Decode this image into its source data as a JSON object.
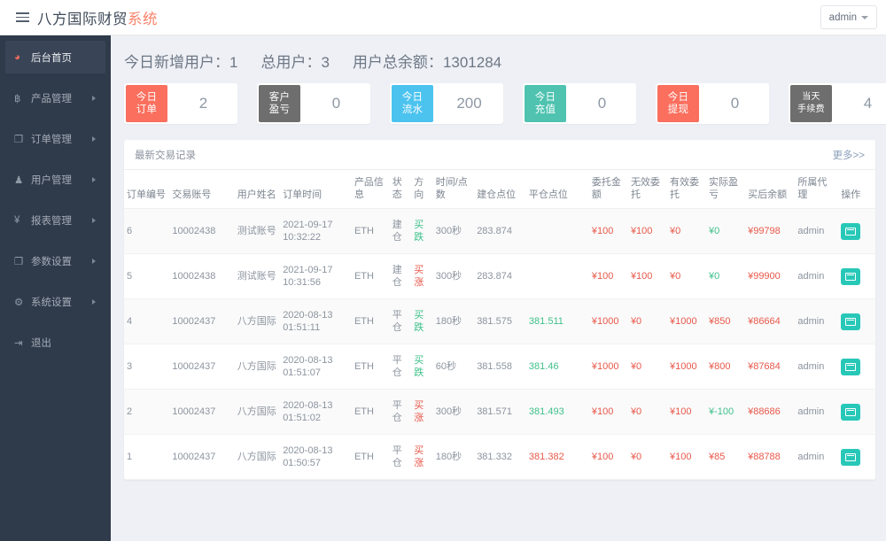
{
  "topbar": {
    "menu_icon": "hamburger-icon",
    "brand_main": "八方国际财贸",
    "brand_accent": "系统",
    "user_label": "admin"
  },
  "sidebar": {
    "items": [
      {
        "label": "后台首页",
        "icon": "dashboard-icon",
        "icon_glyph": "◕",
        "active": true,
        "arrow": false
      },
      {
        "label": "产品管理",
        "icon": "bitcoin-icon",
        "icon_glyph": "฿",
        "active": false,
        "arrow": true
      },
      {
        "label": "订单管理",
        "icon": "copy-icon",
        "icon_glyph": "❐",
        "active": false,
        "arrow": true
      },
      {
        "label": "用户管理",
        "icon": "user-icon",
        "icon_glyph": "♟",
        "active": false,
        "arrow": true
      },
      {
        "label": "报表管理",
        "icon": "yen-icon",
        "icon_glyph": "¥",
        "active": false,
        "arrow": true
      },
      {
        "label": "参数设置",
        "icon": "copy-icon",
        "icon_glyph": "❐",
        "active": false,
        "arrow": true
      },
      {
        "label": "系统设置",
        "icon": "gears-icon",
        "icon_glyph": "⚙",
        "active": false,
        "arrow": true
      },
      {
        "label": "退出",
        "icon": "logout-icon",
        "icon_glyph": "⇥",
        "active": false,
        "arrow": false
      }
    ]
  },
  "stats": [
    {
      "label": "今日新增用户：",
      "value": "1"
    },
    {
      "label": "总用户：",
      "value": "3"
    },
    {
      "label": "用户总余额：",
      "value": "1301284"
    }
  ],
  "cards": [
    {
      "tag": "今日订单",
      "tag_line1": "今日",
      "tag_line2": "订单",
      "value": "2",
      "color": "#fa6f5e"
    },
    {
      "tag": "客户盈亏",
      "tag_line1": "客户",
      "tag_line2": "盈亏",
      "value": "0",
      "color": "#6e6e6e"
    },
    {
      "tag": "今日流水",
      "tag_line1": "今日",
      "tag_line2": "流水",
      "value": "200",
      "color": "#4cc3ef"
    },
    {
      "tag": "今日充值",
      "tag_line1": "今日",
      "tag_line2": "充值",
      "value": "0",
      "color": "#4fc3b0"
    },
    {
      "tag": "今日提现",
      "tag_line1": "今日",
      "tag_line2": "提现",
      "value": "0",
      "color": "#fa6f5e"
    },
    {
      "tag": "当天手续费",
      "tag_line1": "当天",
      "tag_line2": "手续费",
      "value": "4",
      "color": "#6e6e6e"
    }
  ],
  "panel": {
    "title": "最新交易记录",
    "more_label": "更多>>",
    "columns": [
      "订单编号",
      "交易账号",
      "用户姓名",
      "订单时间",
      "产品信息",
      "状态",
      "方向",
      "时间/点数",
      "建仓点位",
      "平仓点位",
      "委托金额",
      "无效委托",
      "有效委托",
      "实际盈亏",
      "买后余额",
      "所属代理",
      "操作"
    ],
    "rows": [
      {
        "id": "6",
        "account": "10002438",
        "name": "测试账号",
        "order_time": "2021-09-17 10:32:22",
        "product": "ETH",
        "status": "建仓",
        "direction": "买跌",
        "direction_color": "green",
        "duration": "300秒",
        "open_price": "283.874",
        "close_price": "",
        "close_color": "gray",
        "entrust_amount": "¥100",
        "invalid_entrust": "¥100",
        "valid_entrust": "¥0",
        "profit": "¥0",
        "profit_color": "green",
        "balance": "¥99798",
        "agent": "admin"
      },
      {
        "id": "5",
        "account": "10002438",
        "name": "测试账号",
        "order_time": "2021-09-17 10:31:56",
        "product": "ETH",
        "status": "建仓",
        "direction": "买涨",
        "direction_color": "red",
        "duration": "300秒",
        "open_price": "283.874",
        "close_price": "",
        "close_color": "gray",
        "entrust_amount": "¥100",
        "invalid_entrust": "¥100",
        "valid_entrust": "¥0",
        "profit": "¥0",
        "profit_color": "green",
        "balance": "¥99900",
        "agent": "admin"
      },
      {
        "id": "4",
        "account": "10002437",
        "name": "八方国际",
        "order_time": "2020-08-13 01:51:11",
        "product": "ETH",
        "status": "平仓",
        "direction": "买跌",
        "direction_color": "green",
        "duration": "180秒",
        "open_price": "381.575",
        "close_price": "381.511",
        "close_color": "green",
        "entrust_amount": "¥1000",
        "invalid_entrust": "¥0",
        "valid_entrust": "¥1000",
        "profit": "¥850",
        "profit_color": "red",
        "balance": "¥86664",
        "agent": "admin"
      },
      {
        "id": "3",
        "account": "10002437",
        "name": "八方国际",
        "order_time": "2020-08-13 01:51:07",
        "product": "ETH",
        "status": "平仓",
        "direction": "买跌",
        "direction_color": "green",
        "duration": "60秒",
        "open_price": "381.558",
        "close_price": "381.46",
        "close_color": "green",
        "entrust_amount": "¥1000",
        "invalid_entrust": "¥0",
        "valid_entrust": "¥1000",
        "profit": "¥800",
        "profit_color": "red",
        "balance": "¥87684",
        "agent": "admin"
      },
      {
        "id": "2",
        "account": "10002437",
        "name": "八方国际",
        "order_time": "2020-08-13 01:51:02",
        "product": "ETH",
        "status": "平仓",
        "direction": "买涨",
        "direction_color": "red",
        "duration": "300秒",
        "open_price": "381.571",
        "close_price": "381.493",
        "close_color": "green",
        "entrust_amount": "¥100",
        "invalid_entrust": "¥0",
        "valid_entrust": "¥100",
        "profit": "¥-100",
        "profit_color": "green",
        "balance": "¥88686",
        "agent": "admin"
      },
      {
        "id": "1",
        "account": "10002437",
        "name": "八方国际",
        "order_time": "2020-08-13 01:50:57",
        "product": "ETH",
        "status": "平仓",
        "direction": "买涨",
        "direction_color": "red",
        "duration": "180秒",
        "open_price": "381.332",
        "close_price": "381.382",
        "close_color": "red",
        "entrust_amount": "¥100",
        "invalid_entrust": "¥0",
        "valid_entrust": "¥100",
        "profit": "¥85",
        "profit_color": "red",
        "balance": "¥88788",
        "agent": "admin"
      }
    ],
    "op_icon": "window-icon"
  },
  "colors": {
    "accent_red": "#e8584a",
    "accent_green": "#3ec08a",
    "brand_accent": "#f8836b",
    "sidebar_bg": "#2f3a4b",
    "op_button": "#28c8b8"
  }
}
